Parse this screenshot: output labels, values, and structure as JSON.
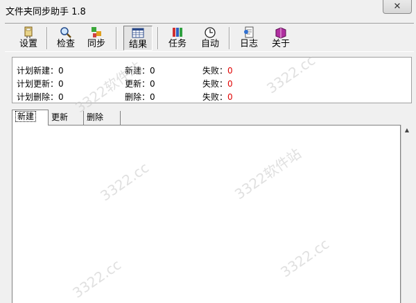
{
  "window": {
    "title": "文件夹同步助手 1.8",
    "close_glyph": "✕"
  },
  "toolbar": {
    "buttons": [
      {
        "label": "设置",
        "icon": "settings-icon"
      },
      {
        "label": "检查",
        "icon": "magnifier-icon"
      },
      {
        "label": "同步",
        "icon": "sync-icon"
      },
      {
        "label": "结果",
        "icon": "table-icon",
        "active": true
      },
      {
        "label": "任务",
        "icon": "tasks-icon"
      },
      {
        "label": "自动",
        "icon": "clock-icon"
      },
      {
        "label": "日志",
        "icon": "log-icon"
      },
      {
        "label": "关于",
        "icon": "book-icon"
      }
    ]
  },
  "stats": {
    "plan_new": {
      "label": "计划新建：",
      "value": "0"
    },
    "plan_update": {
      "label": "计划更新：",
      "value": "0"
    },
    "plan_delete": {
      "label": "计划删除：",
      "value": "0"
    },
    "new": {
      "label": "新建：",
      "value": "0"
    },
    "update": {
      "label": "更新：",
      "value": "0"
    },
    "delete": {
      "label": "删除：",
      "value": "0"
    },
    "fail_new": {
      "label": "失败：",
      "value": "0"
    },
    "fail_update": {
      "label": "失败：",
      "value": "0"
    },
    "fail_delete": {
      "label": "失败：",
      "value": "0"
    }
  },
  "tabs": [
    {
      "label": "新建",
      "active": true
    },
    {
      "label": "更新"
    },
    {
      "label": "删除"
    }
  ],
  "watermark": {
    "text_cn": "3322软件站",
    "text_url": "3322.cc"
  },
  "colors": {
    "fail_value": "#e00000",
    "background": "#f0f0f0"
  }
}
